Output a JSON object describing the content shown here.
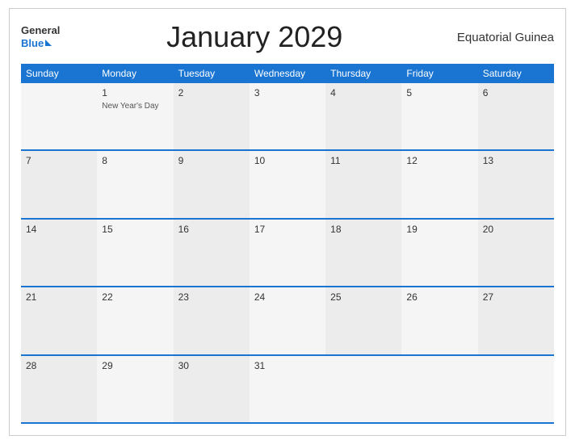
{
  "header": {
    "title": "January 2029",
    "country": "Equatorial Guinea",
    "logo_general": "General",
    "logo_blue": "Blue"
  },
  "days": [
    "Sunday",
    "Monday",
    "Tuesday",
    "Wednesday",
    "Thursday",
    "Friday",
    "Saturday"
  ],
  "weeks": [
    [
      {
        "date": "",
        "event": ""
      },
      {
        "date": "1",
        "event": "New Year's Day"
      },
      {
        "date": "2",
        "event": ""
      },
      {
        "date": "3",
        "event": ""
      },
      {
        "date": "4",
        "event": ""
      },
      {
        "date": "5",
        "event": ""
      },
      {
        "date": "6",
        "event": ""
      }
    ],
    [
      {
        "date": "7",
        "event": ""
      },
      {
        "date": "8",
        "event": ""
      },
      {
        "date": "9",
        "event": ""
      },
      {
        "date": "10",
        "event": ""
      },
      {
        "date": "11",
        "event": ""
      },
      {
        "date": "12",
        "event": ""
      },
      {
        "date": "13",
        "event": ""
      }
    ],
    [
      {
        "date": "14",
        "event": ""
      },
      {
        "date": "15",
        "event": ""
      },
      {
        "date": "16",
        "event": ""
      },
      {
        "date": "17",
        "event": ""
      },
      {
        "date": "18",
        "event": ""
      },
      {
        "date": "19",
        "event": ""
      },
      {
        "date": "20",
        "event": ""
      }
    ],
    [
      {
        "date": "21",
        "event": ""
      },
      {
        "date": "22",
        "event": ""
      },
      {
        "date": "23",
        "event": ""
      },
      {
        "date": "24",
        "event": ""
      },
      {
        "date": "25",
        "event": ""
      },
      {
        "date": "26",
        "event": ""
      },
      {
        "date": "27",
        "event": ""
      }
    ],
    [
      {
        "date": "28",
        "event": ""
      },
      {
        "date": "29",
        "event": ""
      },
      {
        "date": "30",
        "event": ""
      },
      {
        "date": "31",
        "event": ""
      },
      {
        "date": "",
        "event": ""
      },
      {
        "date": "",
        "event": ""
      },
      {
        "date": "",
        "event": ""
      }
    ]
  ]
}
